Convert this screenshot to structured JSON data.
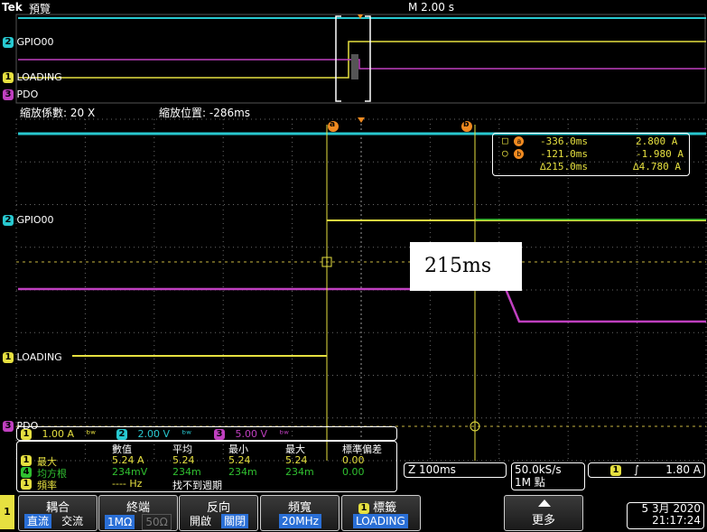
{
  "header": {
    "brand": "Tek",
    "mode": "預覽",
    "timebase": "M 2.00 s"
  },
  "overview": {
    "labels": [
      {
        "num": "2",
        "name": "GPIO00",
        "color": "#28c8d0"
      },
      {
        "num": "1",
        "name": "LOADING",
        "color": "#e6e040"
      },
      {
        "num": "3",
        "name": "PDO",
        "color": "#c040c0"
      }
    ]
  },
  "zoom": {
    "factor_label": "縮放係數: 20 X",
    "position_label": "縮放位置: -286ms"
  },
  "main_labels": {
    "gpio": "GPIO00",
    "gpio_num": "2",
    "loading": "LOADING",
    "loading_num": "1",
    "pdo": "PDO",
    "pdo_num": "3"
  },
  "cursor_markers": {
    "a": "a",
    "b": "b"
  },
  "cursor_readout": {
    "a_time": "-336.0ms",
    "a_value": "2.800 A",
    "b_time": "-121.0ms",
    "b_value": "-1.980 A",
    "delta_time": "∆215.0ms",
    "delta_value": "∆4.780 A"
  },
  "annotation": {
    "text": "215ms"
  },
  "channel_strip": {
    "ch1": {
      "num": "1",
      "scale": "1.00 A",
      "color": "#e6e040"
    },
    "ch2": {
      "num": "2",
      "scale": "2.00 V",
      "color": "#28c8d0"
    },
    "ch3": {
      "num": "3",
      "scale": "5.00 V",
      "color": "#c040c0"
    },
    "bw_symbol": "ᵇʷ"
  },
  "measurements": {
    "headers": [
      "數值",
      "平均",
      "最小",
      "最大",
      "標準偏差"
    ],
    "rows": [
      {
        "num": "1",
        "color": "#e6e040",
        "label": "最大",
        "value": "5.24 A",
        "mean": "5.24",
        "min": "5.24",
        "max": "5.24",
        "std": "0.00"
      },
      {
        "num": "4",
        "color": "#30c030",
        "label": "均方根",
        "value": "234mV",
        "mean": "234m",
        "min": "234m",
        "max": "234m",
        "std": "0.00"
      },
      {
        "num": "1",
        "color": "#e6e040",
        "label": "頻率",
        "value": "---- Hz",
        "note": "找不到週期"
      }
    ]
  },
  "horizontal": {
    "zoom": "Z 100ms",
    "rate": "50.0kS/s",
    "points": "1M 點"
  },
  "trigger": {
    "num": "1",
    "slope": "∫",
    "level": "1.80 A"
  },
  "menu": {
    "channel_num": "1",
    "coupling": {
      "title": "耦合",
      "opt1": "直流",
      "opt2": "交流"
    },
    "termination": {
      "title": "終端",
      "opt1": "1MΩ",
      "opt2": "50Ω"
    },
    "invert": {
      "title": "反向",
      "opt1": "開啟",
      "opt2": "關閉"
    },
    "bandwidth": {
      "title": "頻寬",
      "value": "20MHz"
    },
    "label_btn": {
      "num": "1",
      "title": "標籤",
      "value": "LOADING"
    },
    "more": {
      "title": "更多"
    }
  },
  "datetime": {
    "date": "5 3月 2020",
    "time": "21:17:24"
  },
  "colors": {
    "ch1": "#e6e040",
    "ch2": "#28c8d0",
    "ch3": "#c040c0",
    "grid": "#6a6a6a",
    "accent": "#2a6fd6"
  }
}
